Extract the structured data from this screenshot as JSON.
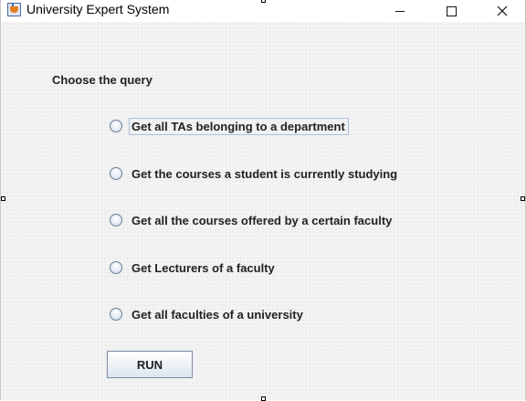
{
  "window": {
    "title": "University Expert System"
  },
  "form": {
    "prompt": "Choose the query",
    "options": [
      {
        "label": "Get all TAs belonging to a department",
        "selected": false
      },
      {
        "label": "Get the courses a student is currently studying",
        "selected": false
      },
      {
        "label": "Get all the courses offered by a certain faculty",
        "selected": false
      },
      {
        "label": "Get Lecturers of a faculty",
        "selected": false
      },
      {
        "label": "Get all faculties of a university",
        "selected": false
      }
    ],
    "run_label": "RUN"
  },
  "icons": {
    "app": "java-coffee-cup-icon",
    "minimize": "minimize-icon",
    "maximize": "maximize-icon",
    "close": "close-icon"
  }
}
